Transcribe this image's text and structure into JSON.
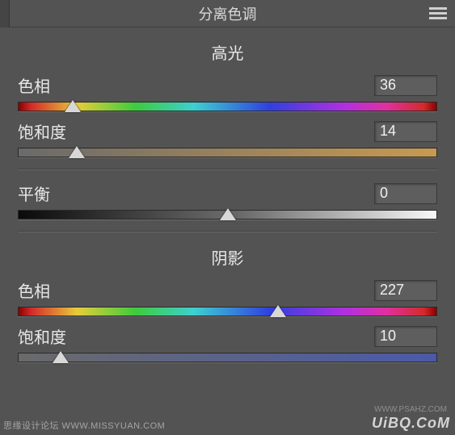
{
  "header": {
    "title": "分离色调"
  },
  "sections": {
    "highlights": {
      "title": "高光",
      "hue": {
        "label": "色相",
        "value": "36",
        "pos": 13
      },
      "saturation": {
        "label": "饱和度",
        "value": "14",
        "pos": 14
      }
    },
    "balance": {
      "label": "平衡",
      "value": "0",
      "pos": 50
    },
    "shadows": {
      "title": "阴影",
      "hue": {
        "label": "色相",
        "value": "227",
        "pos": 62
      },
      "saturation": {
        "label": "饱和度",
        "value": "10",
        "pos": 10
      }
    }
  },
  "watermarks": {
    "left": "思缘设计论坛  WWW.MISSYUAN.COM",
    "right": "UiBQ.CoM",
    "right2": "WWW.PSAHZ.COM"
  }
}
